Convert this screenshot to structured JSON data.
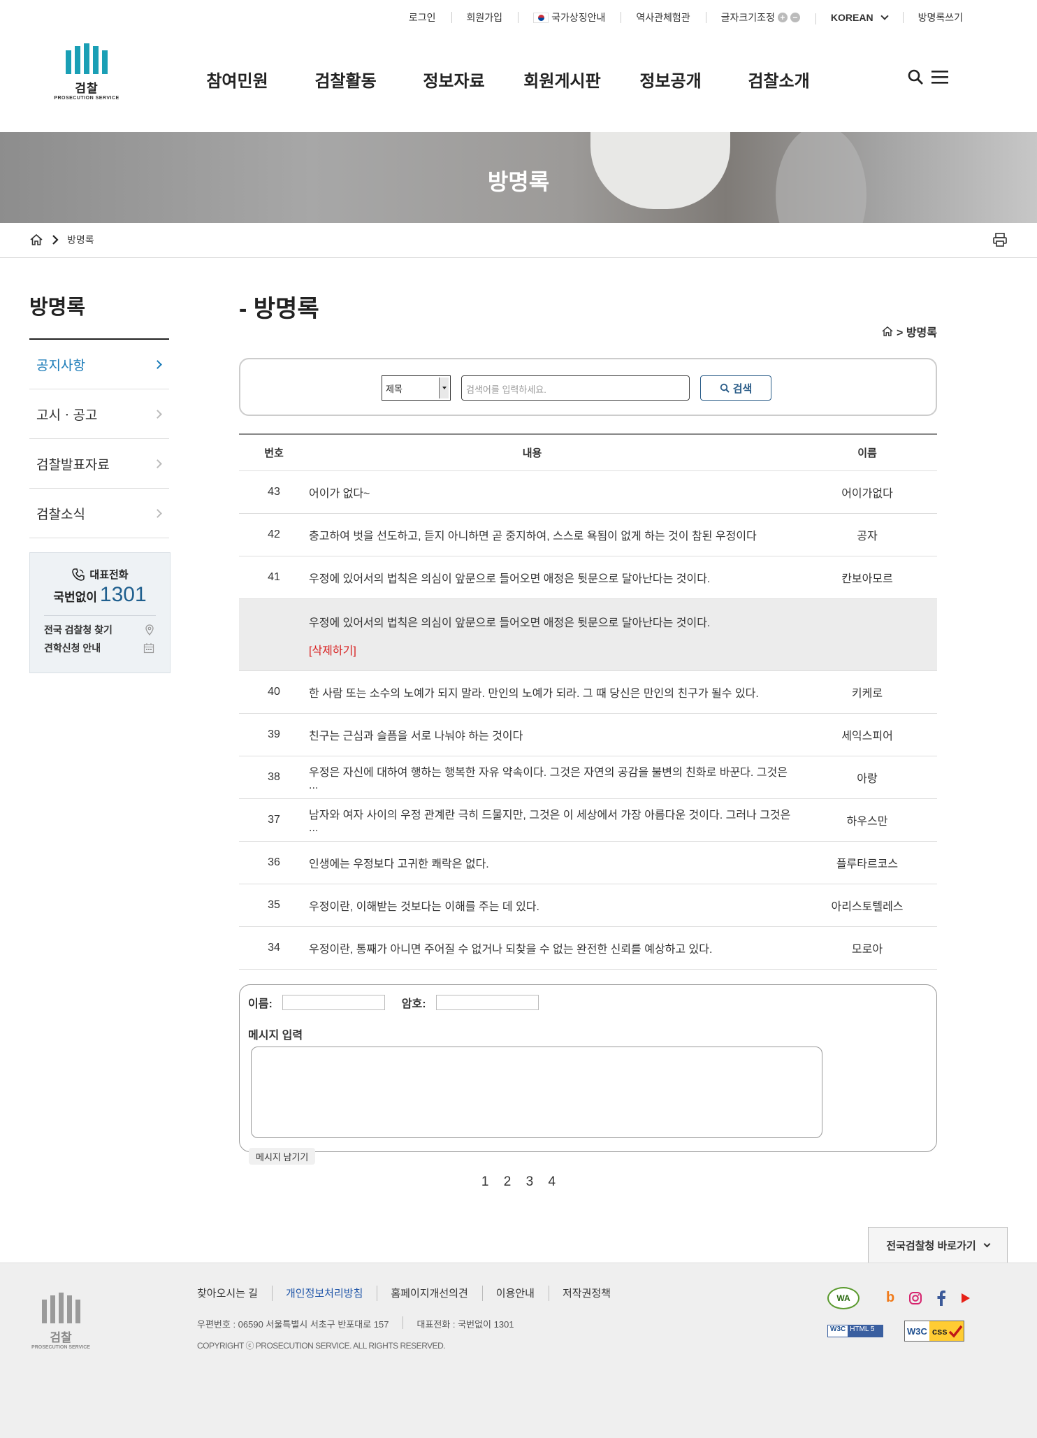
{
  "util": {
    "login": "로그인",
    "join": "회원가입",
    "symbol": "국가상징안내",
    "history": "역사관체험관",
    "font_size": "글자크기조정",
    "plus": "+",
    "minus": "−",
    "language": "KOREAN",
    "guestbook_write": "방명록쓰기"
  },
  "logo": {
    "name": "검찰",
    "sub": "PROSECUTION SERVICE"
  },
  "gnb": [
    "참여민원",
    "검찰활동",
    "정보자료",
    "회원게시판",
    "정보공개",
    "검찰소개"
  ],
  "visual": {
    "title": "방명록"
  },
  "breadcrumb": {
    "current": "방명록"
  },
  "lnb": {
    "title": "방명록",
    "items": [
      "공지사항",
      "고시ㆍ공고",
      "검찰발표자료",
      "검찰소식"
    ]
  },
  "callbox": {
    "label": "대표전화",
    "prefix": "국번없이",
    "number": "1301",
    "link1": "전국 검찰청 찾기",
    "link2": "견학신청 안내"
  },
  "content": {
    "title": "- 방명록",
    "path": "> 방명록"
  },
  "search": {
    "select_value": "제목",
    "placeholder": "검색어를 입력하세요.",
    "button": "검색"
  },
  "table": {
    "headers": [
      "번호",
      "내용",
      "이름"
    ],
    "rows": [
      {
        "no": "43",
        "content": "어이가 없다~",
        "name": "어이가없다"
      },
      {
        "no": "42",
        "content": "충고하여 벗을 선도하고, 듣지 아니하면 곧 중지하여, 스스로 욕됨이 없게 하는 것이 참된 우정이다",
        "name": "공자"
      },
      {
        "no": "41",
        "content": "우정에 있어서의 법칙은 의심이 앞문으로 들어오면 애정은 뒷문으로 달아난다는 것이다.",
        "name": "칸보아모르"
      },
      {
        "no": "40",
        "content": "한 사람 또는 소수의 노예가 되지 말라. 만인의 노예가 되라. 그 때 당신은 만인의 친구가 될수 있다.",
        "name": "키케로"
      },
      {
        "no": "39",
        "content": "친구는 근심과 슬픔을 서로 나눠야 하는 것이다",
        "name": "세익스피어"
      },
      {
        "no": "38",
        "content": "우정은 자신에 대하여 행하는 행복한 자유 약속이다. 그것은 자연의 공감을 불변의 친화로 바꾼다. 그것은 ...",
        "name": "아랑"
      },
      {
        "no": "37",
        "content": "남자와 여자 사이의 우정 관계란 극히 드물지만, 그것은 이 세상에서 가장 아름다운 것이다. 그러나 그것은 ...",
        "name": "하우스만"
      },
      {
        "no": "36",
        "content": "인생에는 우정보다 고귀한 쾌락은 없다.",
        "name": "플루타르코스"
      },
      {
        "no": "35",
        "content": "우정이란, 이해받는 것보다는 이해를 주는 데 있다.",
        "name": "아리스토텔레스"
      },
      {
        "no": "34",
        "content": "우정이란, 통째가 아니면 주어질 수 없거나 되찾을 수 없는 완전한 신뢰를 예상하고 있다.",
        "name": "모로아"
      }
    ],
    "expanded": {
      "content": "우정에 있어서의 법칙은 의심이 앞문으로 들어오면 애정은 뒷문으로 달아난다는 것이다.",
      "delete": "[삭제하기]"
    }
  },
  "write": {
    "name_label": "이름:",
    "pw_label": "암호:",
    "msg_label": "메시지 입력",
    "submit": "메시지 남기기"
  },
  "paging": [
    "1",
    "2",
    "3",
    "4"
  ],
  "go_button": "전국검찰청 바로가기",
  "footer": {
    "links": [
      "찾아오시는 길",
      "개인정보처리방침",
      "홈페이지개선의견",
      "이용안내",
      "저작권정책"
    ],
    "address": "우편번호 : 06590 서울특별시 서초구 반포대로 157",
    "phone": "대표전화 : 국번없이 1301",
    "copyright": "COPYRIGHT ⓒ PROSECUTION SERVICE. ALL RIGHTS RESERVED.",
    "wa_badge": "WA",
    "social": {
      "blog": "b"
    },
    "w3c_html": {
      "a": "W3C",
      "b": "HTML 5"
    },
    "w3c_css": {
      "a": "W3C",
      "b": "css"
    }
  },
  "colors": {
    "brand_teal": "#1a9fb5",
    "active_blue": "#1a7bb8",
    "delete_red": "#d81f1f",
    "link_blue": "#1e54a8"
  }
}
